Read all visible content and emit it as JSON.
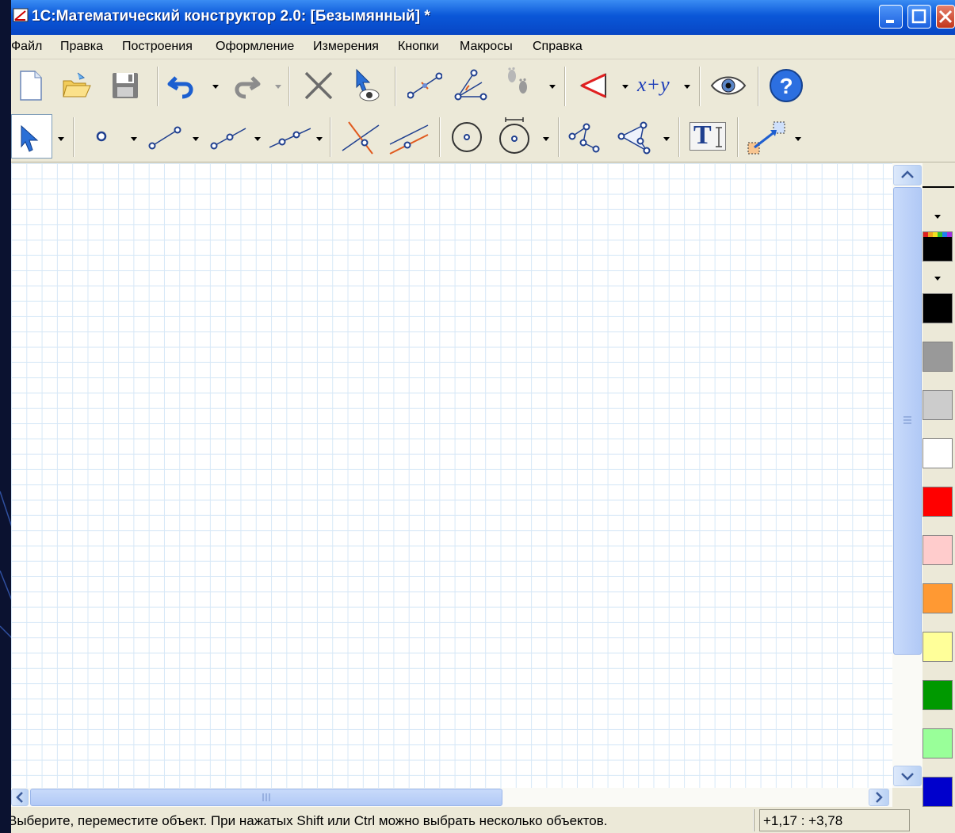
{
  "window": {
    "title": "1С:Математический конструктор 2.0: [Безымянный] *"
  },
  "menu": {
    "items": [
      "Файл",
      "Правка",
      "Построения",
      "Оформление",
      "Измерения",
      "Кнопки",
      "Макросы",
      "Справка"
    ]
  },
  "toolbar1": {
    "formula_label": "x+y"
  },
  "toolbar2": {
    "text_tool_label": "T"
  },
  "status": {
    "message": "Выберите, переместите объект. При нажатых Shift или Ctrl можно выбрать несколько объектов.",
    "coords": "+1,17 :  +3,78"
  },
  "palette": {
    "current_color": "#000000",
    "colors": [
      "#000000",
      "#999999",
      "#cccccc",
      "#ffffff",
      "#ff0000",
      "#ffcccc",
      "#ff9933",
      "#ffff99",
      "#009900",
      "#99ff99",
      "#0000cc"
    ]
  }
}
